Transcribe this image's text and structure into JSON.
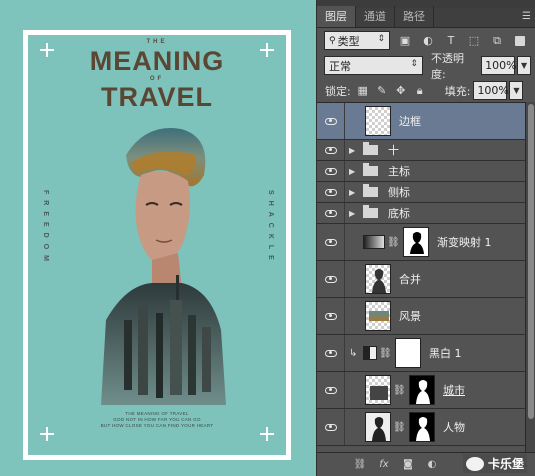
{
  "poster": {
    "title_small_top": "THE",
    "title_line1": "MEANING",
    "title_small_mid": "OF",
    "title_line2": "TRAVEL",
    "side_left": "FREEDOM",
    "side_right": "SHACKLE",
    "bottom_lines": [
      "THE MEANING OF TRAVEL",
      "GOD NOT IN HOW FAR YOU CAN GO",
      "BUT HOW CLOSE YOU CAN FIND YOUR HEART"
    ]
  },
  "panel": {
    "tabs": [
      "图层",
      "通道",
      "路径"
    ],
    "menu_icon": "panel-menu-icon",
    "filter_type": "类型",
    "blend_mode": "正常",
    "opacity_label": "不透明度:",
    "opacity_value": "100%",
    "lock_label": "锁定:",
    "fill_label": "填充:",
    "fill_value": "100%"
  },
  "layers": [
    {
      "name": "边框",
      "kind": "layer",
      "selected": true
    },
    {
      "name": "十",
      "kind": "group"
    },
    {
      "name": "主标",
      "kind": "group"
    },
    {
      "name": "侧标",
      "kind": "group"
    },
    {
      "name": "底标",
      "kind": "group"
    },
    {
      "name": "渐变映射 1",
      "kind": "adjustment"
    },
    {
      "name": "合并",
      "kind": "layer"
    },
    {
      "name": "风景",
      "kind": "layer"
    },
    {
      "name": "黑白 1",
      "kind": "adjustment"
    },
    {
      "name": "城市",
      "kind": "layer"
    },
    {
      "name": "人物",
      "kind": "layer"
    }
  ],
  "watermark": {
    "text": "卡乐堡"
  },
  "colors": {
    "background": "#7ec3bc",
    "poster_title": "#5b4634",
    "panel": "#535353",
    "selected_layer": "#6a7a93"
  }
}
